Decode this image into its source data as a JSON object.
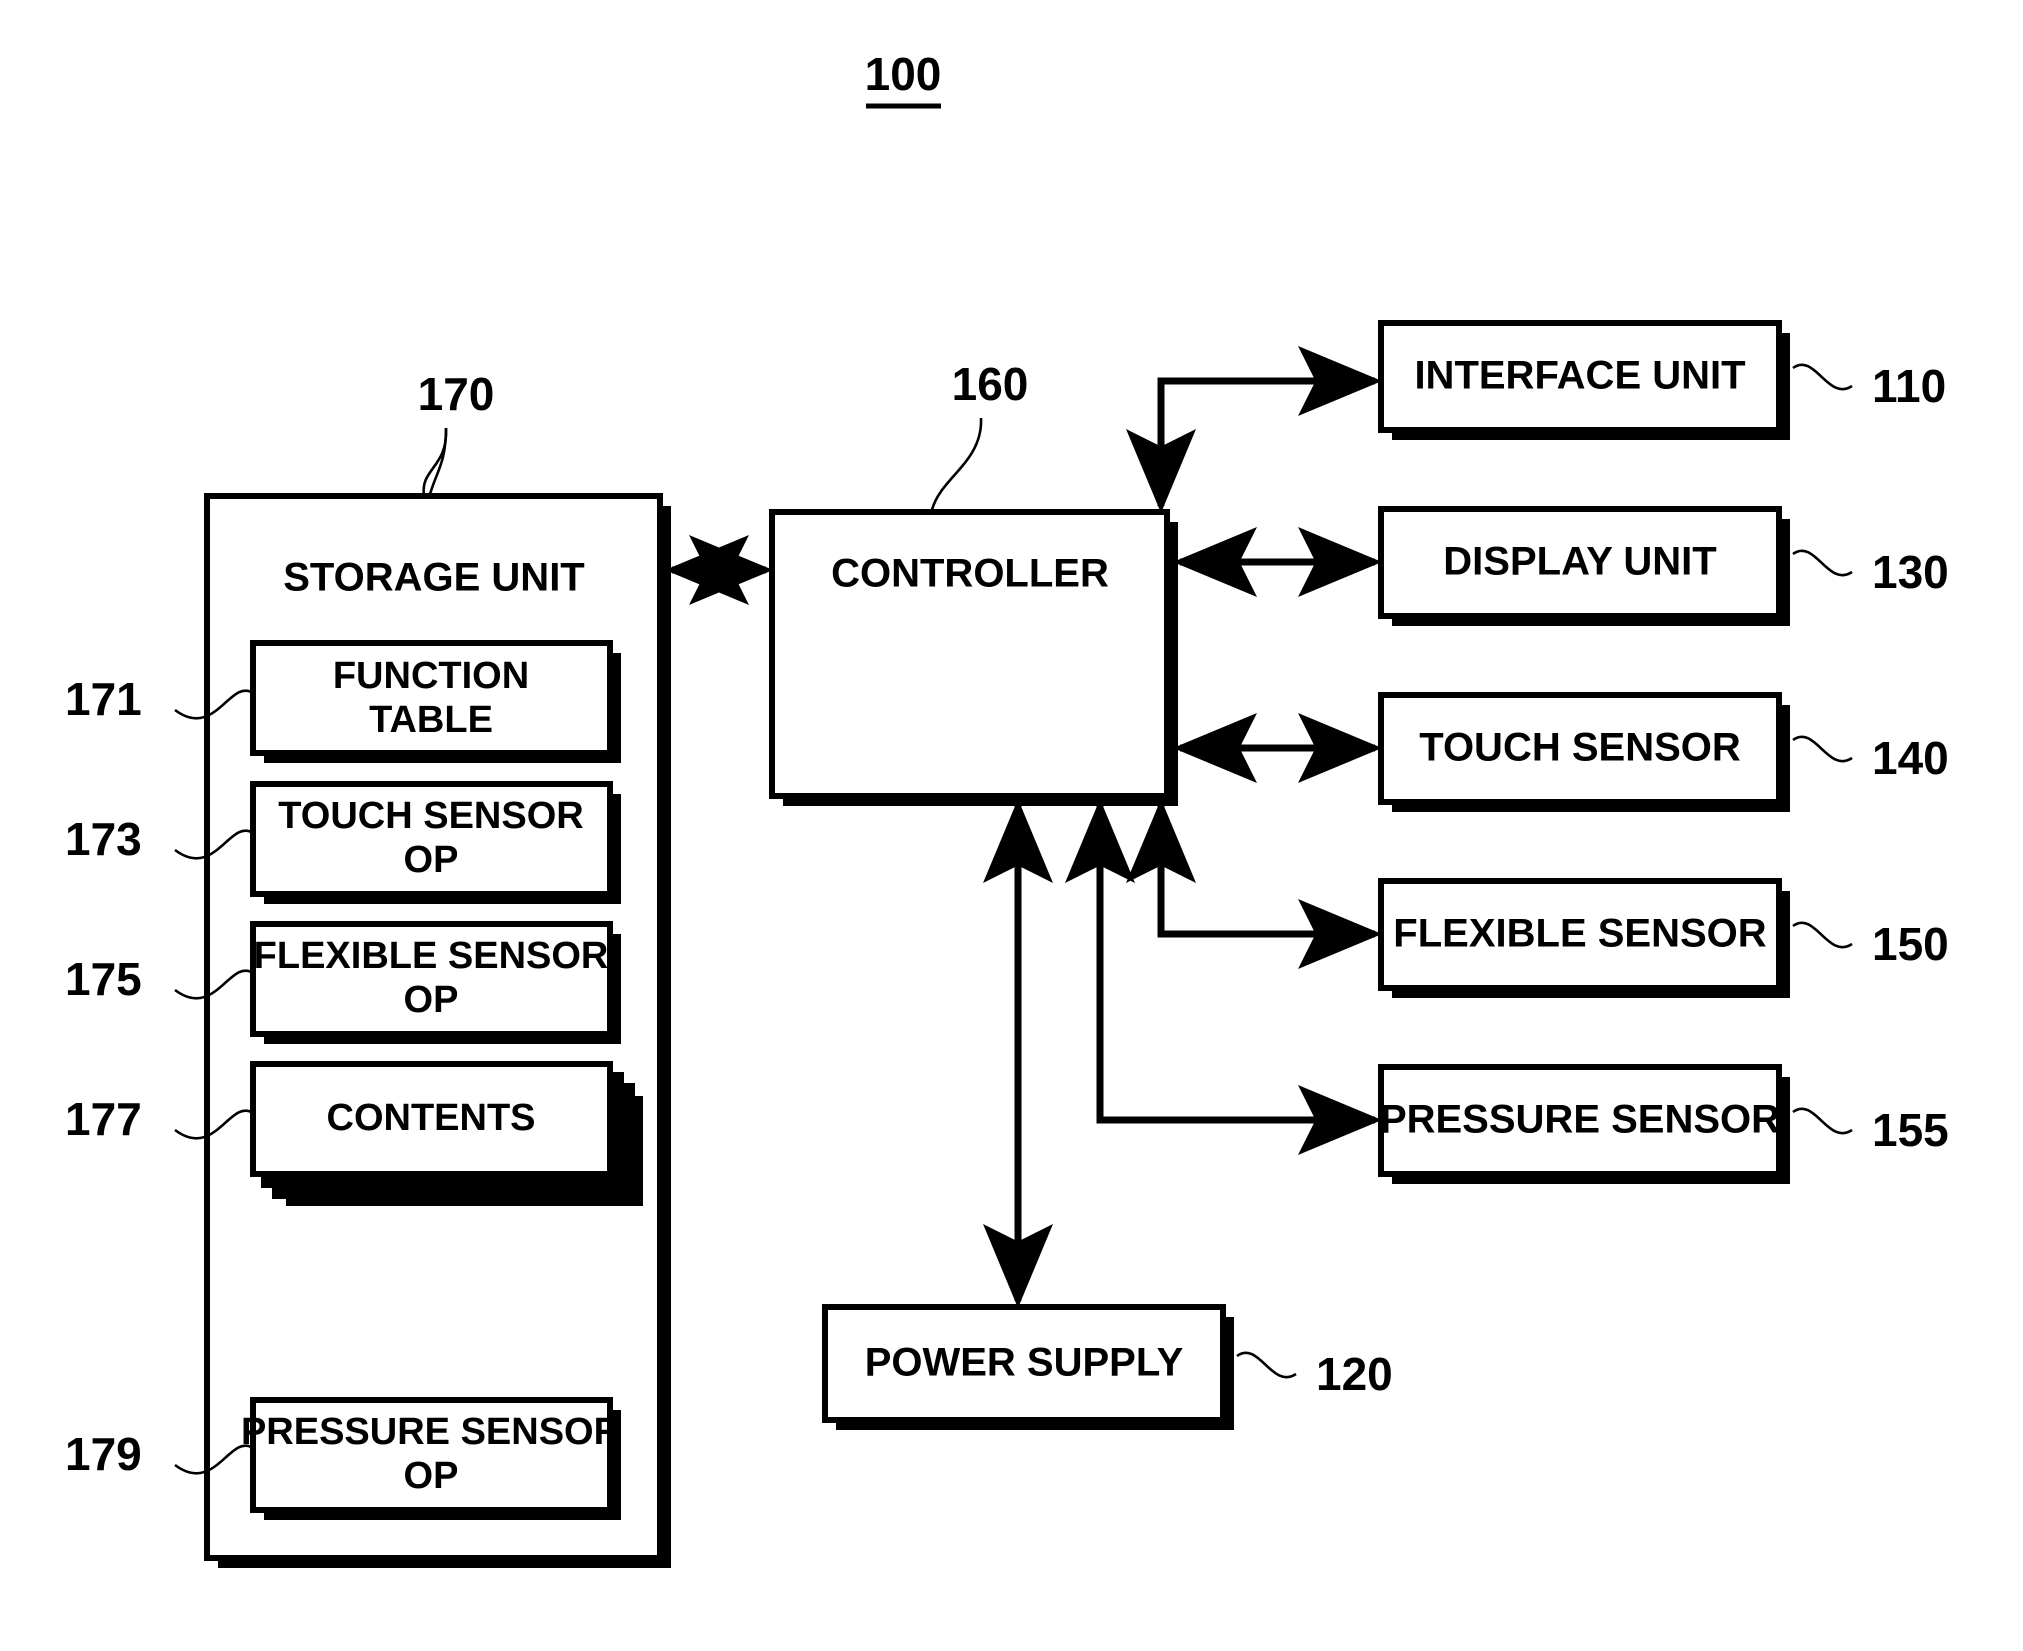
{
  "figure": {
    "title_number": "100",
    "title_underlined": true
  },
  "storage_unit": {
    "ref": "170",
    "label": "STORAGE UNIT",
    "items": [
      {
        "ref": "171",
        "label_line1": "FUNCTION",
        "label_line2": "TABLE",
        "stacked": false
      },
      {
        "ref": "173",
        "label_line1": "TOUCH SENSOR",
        "label_line2": "OP",
        "stacked": false
      },
      {
        "ref": "175",
        "label_line1": "FLEXIBLE SENSOR",
        "label_line2": "OP",
        "stacked": false
      },
      {
        "ref": "177",
        "label_line1": "CONTENTS",
        "label_line2": "",
        "stacked": true
      },
      {
        "ref": "179",
        "label_line1": "PRESSURE SENSOR",
        "label_line2": "OP",
        "stacked": false
      }
    ]
  },
  "controller": {
    "ref": "160",
    "label": "CONTROLLER"
  },
  "power_supply": {
    "ref": "120",
    "label": "POWER SUPPLY"
  },
  "peripherals": [
    {
      "ref": "110",
      "label": "INTERFACE UNIT",
      "arrow": "bidirectional-routed"
    },
    {
      "ref": "130",
      "label": "DISPLAY UNIT",
      "arrow": "bidirectional"
    },
    {
      "ref": "140",
      "label": "TOUCH SENSOR",
      "arrow": "bidirectional"
    },
    {
      "ref": "150",
      "label": "FLEXIBLE SENSOR",
      "arrow": "to-peripheral"
    },
    {
      "ref": "155",
      "label": "PRESSURE SENSOR",
      "arrow": "to-peripheral"
    }
  ],
  "colors": {
    "line": "#000000",
    "fill": "#ffffff"
  }
}
